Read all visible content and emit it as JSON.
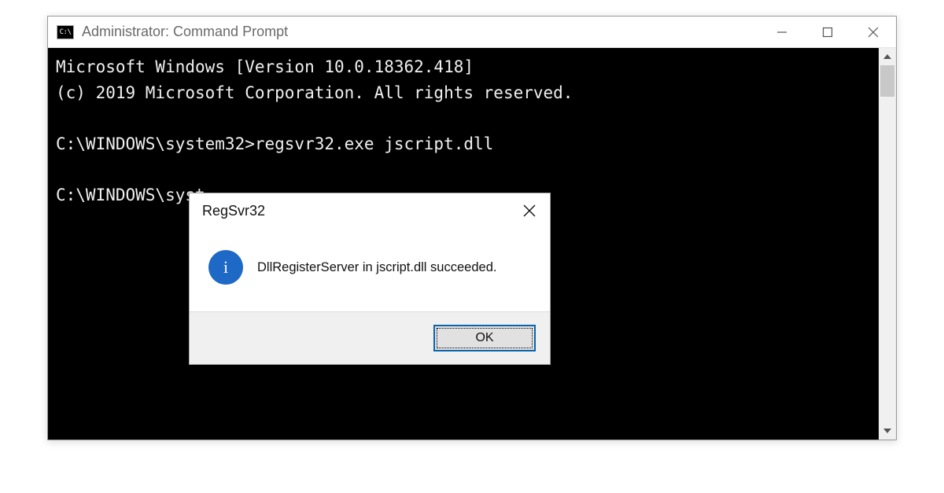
{
  "cmd": {
    "title": "Administrator: Command Prompt",
    "icon_text": "C:\\",
    "lines": {
      "version": "Microsoft Windows [Version 10.0.18362.418]",
      "copyright": "(c) 2019 Microsoft Corporation. All rights reserved.",
      "prompt1": "C:\\WINDOWS\\system32>regsvr32.exe jscript.dll",
      "prompt2_partial": "C:\\WINDOWS\\syst"
    }
  },
  "dialog": {
    "title": "RegSvr32",
    "message": "DllRegisterServer in jscript.dll succeeded.",
    "ok_label": "OK",
    "info_glyph": "i"
  }
}
